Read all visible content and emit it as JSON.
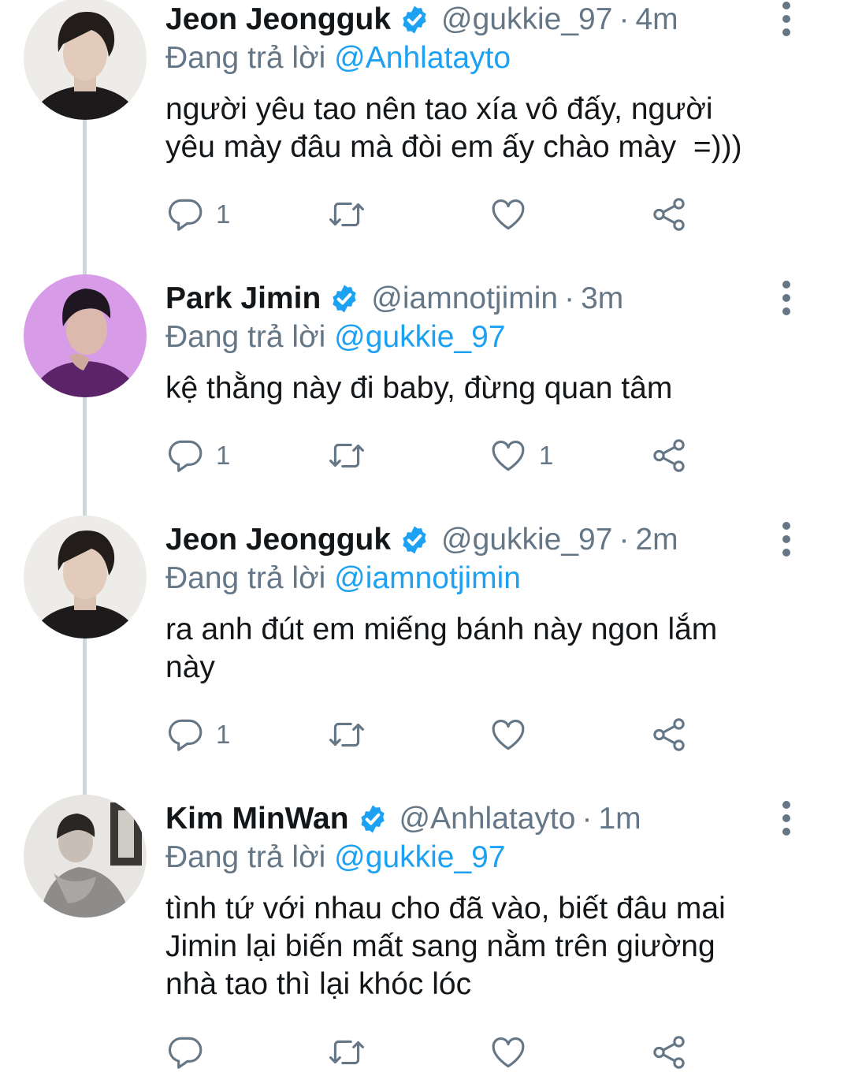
{
  "tweets": [
    {
      "name": "Jeon Jeongguk",
      "handle": "@gukkie_97",
      "time": "4m",
      "replying_label": "Đang trả lời",
      "replying_to": "@Anhlatayto",
      "text": "người yêu tao nên tao xía vô đấy, người\nyêu mày đâu mà đòi em ấy chào mày  =)))",
      "reply_count": "1",
      "retweet_count": "",
      "like_count": ""
    },
    {
      "name": "Park Jimin",
      "handle": "@iamnotjimin",
      "time": "3m",
      "replying_label": "Đang trả lời",
      "replying_to": "@gukkie_97",
      "text": "kệ thằng này đi baby, đừng quan tâm",
      "reply_count": "1",
      "retweet_count": "",
      "like_count": "1"
    },
    {
      "name": "Jeon Jeongguk",
      "handle": "@gukkie_97",
      "time": "2m",
      "replying_label": "Đang trả lời",
      "replying_to": "@iamnotjimin",
      "text": "ra anh đút em miếng bánh này ngon lắm\nnày",
      "reply_count": "1",
      "retweet_count": "",
      "like_count": ""
    },
    {
      "name": "Kim MinWan",
      "handle": "@Anhlatayto",
      "time": "1m",
      "replying_label": "Đang trả lời",
      "replying_to": "@gukkie_97",
      "text": "tình tứ với nhau cho đã vào, biết đâu mai\nJimin lại biến mất sang nằm trên giường\nnhà tao thì lại khóc lóc",
      "reply_count": "",
      "retweet_count": "",
      "like_count": ""
    }
  ],
  "separator": "·",
  "colors": {
    "accent": "#1da1f2",
    "secondary_text": "#657786",
    "thread_line": "#ccd6dd"
  },
  "icons": [
    "verified-badge-icon",
    "more-options-icon",
    "reply-icon",
    "retweet-icon",
    "like-icon",
    "share-icon"
  ]
}
